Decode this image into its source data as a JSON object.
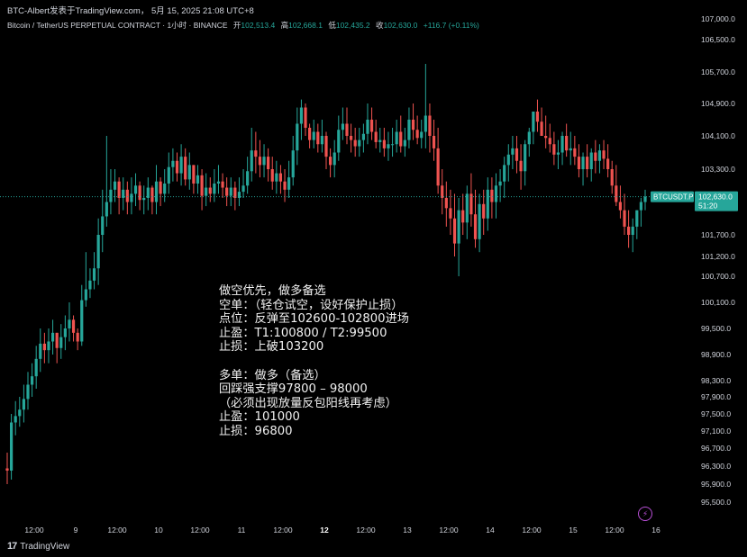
{
  "header": {
    "publisher_line": "BTC-Albert发表于TradingView.com， 5月 15, 2025 21:08 UTC+8",
    "symbol_name": "Bitcoin / TetherUS PERPETUAL CONTRACT · 1小时 · BINANCE",
    "open_label": "开",
    "open_value": "102,513.4",
    "high_label": "高",
    "high_value": "102,668.1",
    "low_label": "低",
    "low_value": "102,435.2",
    "close_label": "收",
    "close_value": "102,630.0",
    "change": "+116.7 (+0.11%)"
  },
  "analysis": {
    "lines": [
      "做空优先，做多备选",
      "空单：（轻仓试空，设好保护止损）",
      "点位：反弹至102600-102800进场",
      "止盈：T1:100800 / T2:99500",
      "止损：上破103200",
      "",
      "多单：做多（备选）",
      "回踩强支撑97800 – 98000",
      "（必须出现放量反包阳线再考虑）",
      "止盈：101000",
      "止损：96800"
    ]
  },
  "footer": {
    "brand": "TradingView",
    "brand_mark": "17"
  },
  "colors": {
    "up": "#26a69a",
    "down": "#ef5350",
    "background": "#000000",
    "text": "#d1d4dc",
    "price_tag": "#26a69a"
  },
  "icons": {
    "bolt": "lightning-icon"
  },
  "chart_data": {
    "type": "candlestick",
    "timeframe": "1小时",
    "yaxis_ticks": [
      107000,
      106500,
      105700,
      104900,
      104100,
      103300,
      101700,
      101200,
      100700,
      100100,
      99500,
      98900,
      98300,
      97900,
      97500,
      97100,
      96700,
      96300,
      95900,
      95500
    ],
    "yaxis_tick_labels": [
      "107,000.0",
      "106,500.0",
      "105,700.0",
      "104,900.0",
      "104,100.0",
      "103,300.0",
      "101,700.0",
      "101,200.0",
      "100,700.0",
      "100,100.0",
      "99,500.0",
      "98,900.0",
      "98,300.0",
      "97,900.0",
      "97,500.0",
      "97,100.0",
      "96,700.0",
      "96,300.0",
      "95,900.0",
      "95,500.0"
    ],
    "xaxis_tick_labels": [
      "12:00",
      "9",
      "12:00",
      "10",
      "12:00",
      "11",
      "12:00",
      "12",
      "12:00",
      "13",
      "12:00",
      "14",
      "12:00",
      "15",
      "12:00",
      "16"
    ],
    "current_price": 102630,
    "current_price_label": "102,630.0",
    "symbol_tag": "BTCUSDT.P",
    "countdown": "51:20",
    "candle_count": 155,
    "series": {
      "open": [
        96250,
        96200,
        97300,
        97450,
        97600,
        97850,
        98200,
        98400,
        98800,
        99150,
        99000,
        99200,
        99400,
        99050,
        99300,
        99500,
        99700,
        99400,
        99200,
        100150,
        100400,
        100600,
        100900,
        101700,
        102150,
        102500,
        102800,
        103000,
        102600,
        102800,
        102500,
        102700,
        102900,
        102550,
        102600,
        102850,
        102500,
        103000,
        102700,
        102950,
        103350,
        103500,
        103200,
        103600,
        103050,
        103400,
        102950,
        103150,
        102650,
        102850,
        102700,
        102950,
        103000,
        102850,
        102650,
        102850,
        102600,
        102750,
        102900,
        103250,
        103750,
        103600,
        103400,
        103600,
        103300,
        103000,
        103200,
        103000,
        102800,
        103100,
        103750,
        104400,
        104800,
        104300,
        104000,
        104200,
        103900,
        104100,
        103600,
        103400,
        103700,
        104250,
        104400,
        104100,
        104000,
        103850,
        104000,
        104150,
        104500,
        104200,
        103950,
        104000,
        103800,
        103900,
        103900,
        104200,
        103850,
        104000,
        104500,
        104250,
        104050,
        104200,
        104600,
        104100,
        103800,
        102900,
        102600,
        102350,
        102100,
        101500,
        102300,
        102000,
        102700,
        102200,
        101600,
        102450,
        102100,
        102800,
        102500,
        102900,
        103000,
        103400,
        103650,
        103800,
        103500,
        103250,
        103900,
        104200,
        104700,
        104450,
        104100,
        104050,
        103900,
        103650,
        103700,
        104100,
        103750,
        103800,
        103600,
        103300,
        103600,
        103300,
        103700,
        103500,
        103750,
        103550,
        103300,
        102900,
        102500,
        102300,
        101900,
        101700,
        101900,
        102300,
        102500
      ],
      "close": [
        96200,
        97300,
        97450,
        97600,
        97850,
        98200,
        98400,
        98800,
        99150,
        99000,
        99200,
        99400,
        99050,
        99300,
        99500,
        99700,
        99400,
        99200,
        100150,
        100400,
        100600,
        100900,
        101700,
        102150,
        102500,
        102800,
        103000,
        102600,
        102800,
        102500,
        102700,
        102900,
        102550,
        102600,
        102850,
        102500,
        103000,
        102700,
        102950,
        103350,
        103500,
        103200,
        103600,
        103050,
        103400,
        102950,
        103150,
        102650,
        102850,
        102700,
        102950,
        103000,
        102850,
        102650,
        102850,
        102600,
        102750,
        102900,
        103250,
        103750,
        103600,
        103400,
        103600,
        103300,
        103000,
        103200,
        103000,
        102800,
        103100,
        103750,
        104400,
        104800,
        104300,
        104000,
        104200,
        103900,
        104100,
        103600,
        103400,
        103700,
        104250,
        104400,
        104100,
        104000,
        103850,
        104000,
        104150,
        104500,
        104200,
        103950,
        104000,
        103800,
        103900,
        103900,
        104200,
        103850,
        104000,
        104500,
        104250,
        104050,
        104200,
        104600,
        104100,
        103800,
        102900,
        102600,
        102350,
        102100,
        101500,
        102300,
        102000,
        102700,
        102200,
        101600,
        102450,
        102100,
        102800,
        102500,
        102900,
        103000,
        103400,
        103650,
        103800,
        103500,
        103250,
        103900,
        104200,
        104700,
        104450,
        104100,
        104050,
        103900,
        103650,
        103700,
        104100,
        103750,
        103800,
        103600,
        103300,
        103600,
        103300,
        103700,
        103500,
        103750,
        103550,
        103300,
        102900,
        102500,
        102300,
        101900,
        101700,
        101900,
        102300,
        102500,
        102630
      ],
      "high": [
        96600,
        97500,
        97800,
        97900,
        98200,
        98500,
        98700,
        99100,
        99500,
        99400,
        99500,
        99700,
        99400,
        99600,
        99800,
        100100,
        99800,
        99500,
        100500,
        101300,
        100900,
        101300,
        102100,
        102800,
        104100,
        103300,
        103300,
        103100,
        103100,
        103000,
        103100,
        103200,
        103000,
        102900,
        103100,
        102900,
        103400,
        103100,
        103300,
        103700,
        103800,
        103700,
        103900,
        103800,
        103700,
        103400,
        103400,
        103300,
        103200,
        103100,
        103300,
        103400,
        103200,
        103100,
        103100,
        103000,
        103100,
        103300,
        103600,
        104300,
        104200,
        104000,
        103900,
        103800,
        103600,
        103500,
        103400,
        103300,
        103500,
        104100,
        104800,
        105000,
        104900,
        104400,
        104500,
        104400,
        104500,
        104200,
        103800,
        104000,
        104600,
        104800,
        104800,
        104400,
        104300,
        104300,
        104400,
        104900,
        104800,
        104500,
        104300,
        104300,
        104200,
        104300,
        104500,
        104600,
        104300,
        104800,
        104900,
        104600,
        104500,
        105900,
        104900,
        104500,
        104300,
        103300,
        103000,
        102800,
        102700,
        102600,
        102700,
        102900,
        103200,
        102800,
        102700,
        102800,
        103100,
        103100,
        103200,
        103300,
        103600,
        103900,
        104100,
        104100,
        103900,
        104000,
        104300,
        104700,
        105000,
        104800,
        104600,
        104400,
        104200,
        104000,
        104200,
        104400,
        104200,
        104100,
        103900,
        103700,
        103900,
        103800,
        104000,
        103900,
        104000,
        103900,
        103500,
        103400,
        102900,
        102700,
        102300,
        102100,
        102300,
        102600,
        102800
      ],
      "low": [
        95900,
        96000,
        97000,
        97200,
        97300,
        97600,
        97900,
        98100,
        98500,
        98700,
        98700,
        98900,
        98700,
        98800,
        99000,
        99200,
        99200,
        99000,
        99100,
        100000,
        100200,
        100400,
        100500,
        101300,
        101900,
        102200,
        102500,
        102200,
        102300,
        102200,
        102200,
        102400,
        102300,
        102200,
        102300,
        102200,
        102200,
        102400,
        102500,
        102700,
        103000,
        103000,
        102900,
        102900,
        102800,
        102700,
        102700,
        102300,
        102400,
        102500,
        102500,
        102700,
        102600,
        102400,
        102400,
        102300,
        102400,
        102600,
        102700,
        103000,
        103200,
        103100,
        103100,
        103000,
        102800,
        102700,
        102700,
        102500,
        102600,
        102900,
        103400,
        104000,
        104100,
        103800,
        103800,
        103700,
        103700,
        103300,
        103100,
        103100,
        103500,
        104000,
        103900,
        103700,
        103600,
        103600,
        103700,
        103900,
        104000,
        103800,
        103700,
        103600,
        103500,
        103600,
        103700,
        103700,
        103600,
        103800,
        104000,
        103900,
        103800,
        103800,
        103700,
        103500,
        102700,
        102200,
        101900,
        101700,
        101200,
        100700,
        101700,
        101600,
        101900,
        101400,
        101300,
        101700,
        101800,
        102100,
        102100,
        102500,
        102600,
        103000,
        103300,
        103200,
        102800,
        102900,
        103600,
        103900,
        104200,
        104100,
        103800,
        103700,
        103400,
        103300,
        103400,
        103600,
        103400,
        103400,
        103100,
        102900,
        103100,
        103000,
        103200,
        103200,
        103300,
        103100,
        102700,
        102400,
        102100,
        101700,
        101400,
        101300,
        101600,
        101900,
        102300
      ]
    }
  }
}
